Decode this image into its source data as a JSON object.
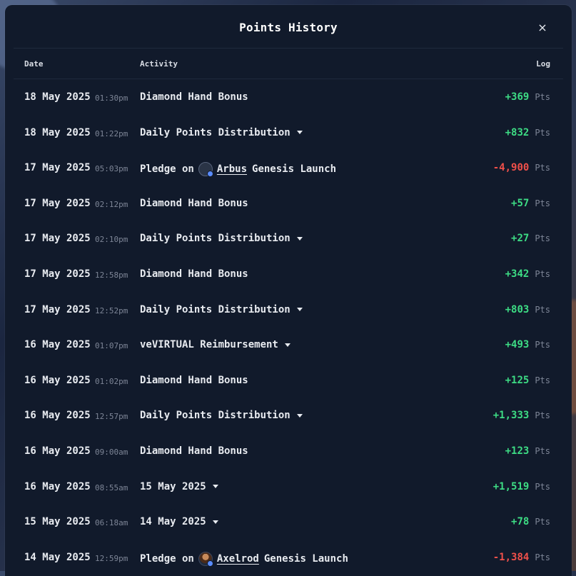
{
  "modal": {
    "title": "Points History",
    "close_label": "×"
  },
  "columns": {
    "date": "Date",
    "activity": "Activity",
    "log": "Log"
  },
  "colors": {
    "positive": "#3ddc84",
    "negative": "#f0504a",
    "background": "#111a2b"
  },
  "rows": [
    {
      "date": "18 May 2025",
      "time": "01:30pm",
      "activity": "Diamond Hand Bonus",
      "expandable": false,
      "value": "+369",
      "unit": "Pts",
      "sign": "pos"
    },
    {
      "date": "18 May 2025",
      "time": "01:22pm",
      "activity": "Daily Points Distribution",
      "expandable": true,
      "value": "+832",
      "unit": "Pts",
      "sign": "pos"
    },
    {
      "date": "17 May 2025",
      "time": "05:03pm",
      "activity_prefix": "Pledge on",
      "token": "Arbus",
      "token_icon": "arbus-token-icon",
      "activity_suffix": "Genesis Launch",
      "value": "-4,900",
      "unit": "Pts",
      "sign": "neg"
    },
    {
      "date": "17 May 2025",
      "time": "02:12pm",
      "activity": "Diamond Hand Bonus",
      "expandable": false,
      "value": "+57",
      "unit": "Pts",
      "sign": "pos"
    },
    {
      "date": "17 May 2025",
      "time": "02:10pm",
      "activity": "Daily Points Distribution",
      "expandable": true,
      "value": "+27",
      "unit": "Pts",
      "sign": "pos"
    },
    {
      "date": "17 May 2025",
      "time": "12:58pm",
      "activity": "Diamond Hand Bonus",
      "expandable": false,
      "value": "+342",
      "unit": "Pts",
      "sign": "pos"
    },
    {
      "date": "17 May 2025",
      "time": "12:52pm",
      "activity": "Daily Points Distribution",
      "expandable": true,
      "value": "+803",
      "unit": "Pts",
      "sign": "pos"
    },
    {
      "date": "16 May 2025",
      "time": "01:07pm",
      "activity": "veVIRTUAL Reimbursement",
      "expandable": true,
      "value": "+493",
      "unit": "Pts",
      "sign": "pos"
    },
    {
      "date": "16 May 2025",
      "time": "01:02pm",
      "activity": "Diamond Hand Bonus",
      "expandable": false,
      "value": "+125",
      "unit": "Pts",
      "sign": "pos"
    },
    {
      "date": "16 May 2025",
      "time": "12:57pm",
      "activity": "Daily Points Distribution",
      "expandable": true,
      "value": "+1,333",
      "unit": "Pts",
      "sign": "pos"
    },
    {
      "date": "16 May 2025",
      "time": "09:00am",
      "activity": "Diamond Hand Bonus",
      "expandable": false,
      "value": "+123",
      "unit": "Pts",
      "sign": "pos"
    },
    {
      "date": "16 May 2025",
      "time": "08:55am",
      "activity": "15 May 2025",
      "expandable": true,
      "value": "+1,519",
      "unit": "Pts",
      "sign": "pos"
    },
    {
      "date": "15 May 2025",
      "time": "06:18am",
      "activity": "14 May 2025",
      "expandable": true,
      "value": "+78",
      "unit": "Pts",
      "sign": "pos"
    },
    {
      "date": "14 May 2025",
      "time": "12:59pm",
      "activity_prefix": "Pledge on",
      "token": "Axelrod",
      "token_icon": "axelrod-token-icon",
      "activity_suffix": "Genesis Launch",
      "value": "-1,384",
      "unit": "Pts",
      "sign": "neg"
    }
  ]
}
